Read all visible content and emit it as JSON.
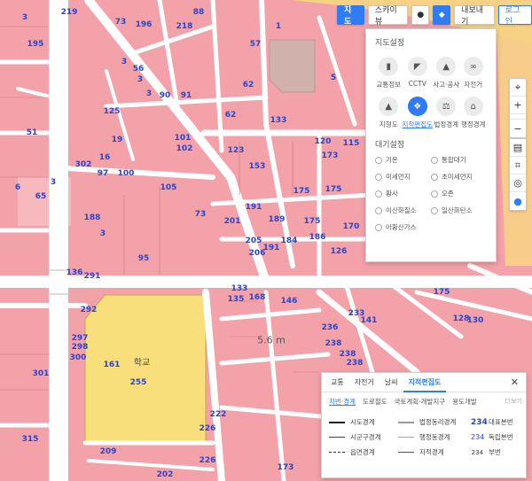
{
  "toolbar": {
    "map_label": "지도",
    "skyview_label": "스카이뷰",
    "export_label": "내보내기",
    "login_label": "로그인"
  },
  "map": {
    "place_text": "학교",
    "parcel_numbers": [
      "219",
      "3",
      "73",
      "195",
      "196",
      "218",
      "88",
      "57",
      "1",
      "3",
      "56",
      "5",
      "3",
      "90",
      "91",
      "62",
      "3",
      "133",
      "125",
      "62",
      "101",
      "102",
      "123",
      "153",
      "173",
      "120",
      "115",
      "19",
      "51",
      "16",
      "302",
      "97",
      "100",
      "105",
      "6",
      "3",
      "175",
      "175",
      "65",
      "73",
      "201",
      "191",
      "189",
      "175",
      "170",
      "126",
      "205",
      "191",
      "184",
      "186",
      "188",
      "3",
      "95",
      "206",
      "136",
      "291",
      "133",
      "135",
      "168",
      "146",
      "292",
      "161",
      "233",
      "141",
      "175",
      "128",
      "130",
      "238",
      "297",
      "298",
      "300",
      "301",
      "255",
      "222",
      "236",
      "238",
      "238",
      "226",
      "315",
      "209",
      "226",
      "202",
      "173"
    ],
    "road_label": "5.6 m"
  },
  "side_controls": {
    "zoom_in": "+",
    "zoom_out": "−"
  },
  "settings": {
    "title": "지도설정",
    "layers": [
      {
        "icon": "traffic-light-icon",
        "glyph": "▮",
        "label": "교통정보"
      },
      {
        "icon": "cctv-icon",
        "glyph": "◤",
        "label": "CCTV"
      },
      {
        "icon": "warning-icon",
        "glyph": "▲",
        "label": "사고·공사"
      },
      {
        "icon": "bicycle-icon",
        "glyph": "∞",
        "label": "자전거"
      },
      {
        "icon": "mountain-icon",
        "glyph": "▲",
        "label": "지형도"
      },
      {
        "icon": "cadastral-icon",
        "glyph": "❖",
        "label": "지적편집도"
      },
      {
        "icon": "scale-icon",
        "glyph": "⚖",
        "label": "법정경계"
      },
      {
        "icon": "building-icon",
        "glyph": "⌂",
        "label": "행정경계"
      }
    ],
    "air_title": "대기설정",
    "air_options": [
      "기온",
      "통합대기",
      "미세먼지",
      "초미세먼지",
      "황사",
      "오존",
      "이산화질소",
      "일산화탄소",
      "아황산가스"
    ]
  },
  "legend": {
    "tabs": [
      "교통",
      "자전거",
      "날씨",
      "지적편집도"
    ],
    "close": "✕",
    "subtabs": [
      "지번·경계",
      "도로철도",
      "국토계획·개발지구",
      "용도개발"
    ],
    "more": "더보기",
    "col1": [
      "시도경계",
      "시군구경계",
      "읍면경계"
    ],
    "col2": [
      "법정동리경계",
      "행정동경계",
      "지적경계"
    ],
    "col3_nums": [
      "234",
      "234",
      "234"
    ],
    "col3_labels": [
      "대표본번",
      "독립본번",
      "부번"
    ]
  },
  "colors": {
    "parcel": "#f4a2a9",
    "school": "#f8df7c",
    "road": "#ffffff",
    "accent": "#2f7cf6",
    "parcel_number": "#2b45c6"
  }
}
